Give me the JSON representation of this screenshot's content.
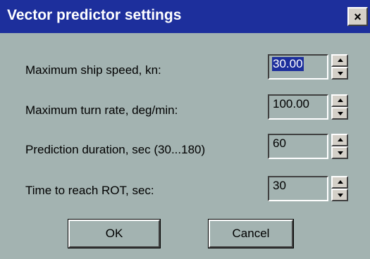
{
  "window": {
    "title": "Vector predictor settings",
    "close_label": "×"
  },
  "fields": [
    {
      "label": "Maximum ship speed, kn:",
      "value": "30.00",
      "selected": true
    },
    {
      "label": "Maximum turn rate, deg/min:",
      "value": "100.00",
      "selected": false
    },
    {
      "label": "Prediction duration, sec (30...180)",
      "value": "60",
      "selected": false
    },
    {
      "label": "Time to reach ROT, sec:",
      "value": "30",
      "selected": false
    }
  ],
  "buttons": {
    "ok": "OK",
    "cancel": "Cancel"
  },
  "colors": {
    "titlebar": "#1d2f9c",
    "background": "#a3b3b1",
    "selection": "#1d2f9c"
  },
  "icons": {
    "close": "close-icon",
    "spin_up": "spin-up-icon",
    "spin_down": "spin-down-icon"
  }
}
